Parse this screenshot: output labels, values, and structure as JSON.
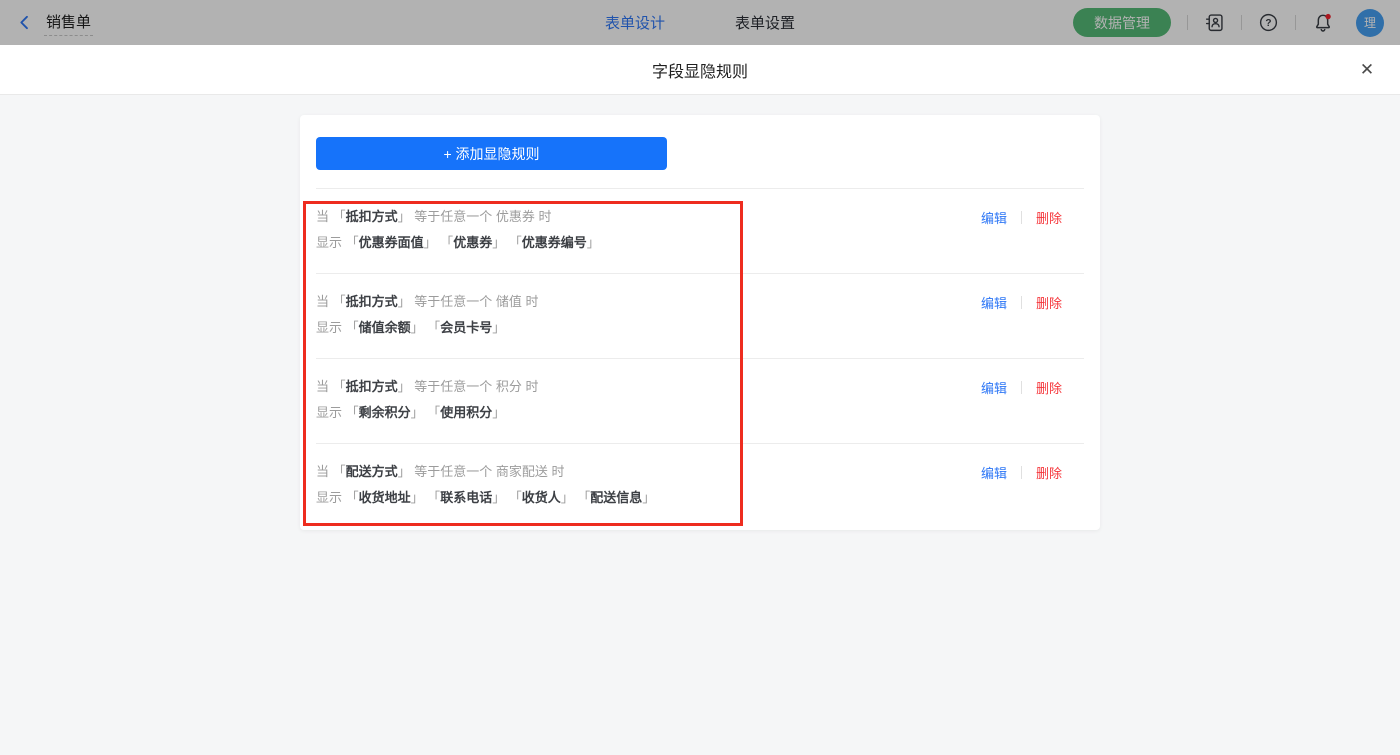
{
  "topbar": {
    "form_title": "销售单",
    "tabs": [
      {
        "label": "表单设计",
        "active": true
      },
      {
        "label": "表单设置",
        "active": false
      }
    ],
    "data_manage_button": "数据管理",
    "help_symbol": "?",
    "avatar_label": "理",
    "notification_has_badge": true
  },
  "modal": {
    "title": "字段显隐规则",
    "close_symbol": "✕",
    "add_rule_button": "+ 添加显隐规则",
    "when_label": "当",
    "operator_label": "等于任意一个",
    "when_suffix": "时",
    "show_label": "显示",
    "edit_label": "编辑",
    "delete_label": "删除",
    "bracket_open": "「",
    "bracket_close": "」",
    "rules": [
      {
        "field": "抵扣方式",
        "value": "优惠券",
        "show_fields": [
          "优惠券面值",
          "优惠券",
          "优惠券编号"
        ]
      },
      {
        "field": "抵扣方式",
        "value": "储值",
        "show_fields": [
          "储值余额",
          "会员卡号"
        ]
      },
      {
        "field": "抵扣方式",
        "value": "积分",
        "show_fields": [
          "剩余积分",
          "使用积分"
        ]
      },
      {
        "field": "配送方式",
        "value": "商家配送",
        "show_fields": [
          "收货地址",
          "联系电话",
          "收货人",
          "配送信息"
        ]
      }
    ]
  },
  "colors": {
    "accent_blue": "#1673FA",
    "link_blue": "#2E77F6",
    "delete_red": "#F5353A",
    "annotation_red": "#EE2C1F",
    "data_manage_green": "#55BB78",
    "avatar_blue": "#459FF2",
    "notification_dot_red": "#F5222D",
    "gray_text": "#9C9C9C",
    "field_text": "#3D4045"
  }
}
